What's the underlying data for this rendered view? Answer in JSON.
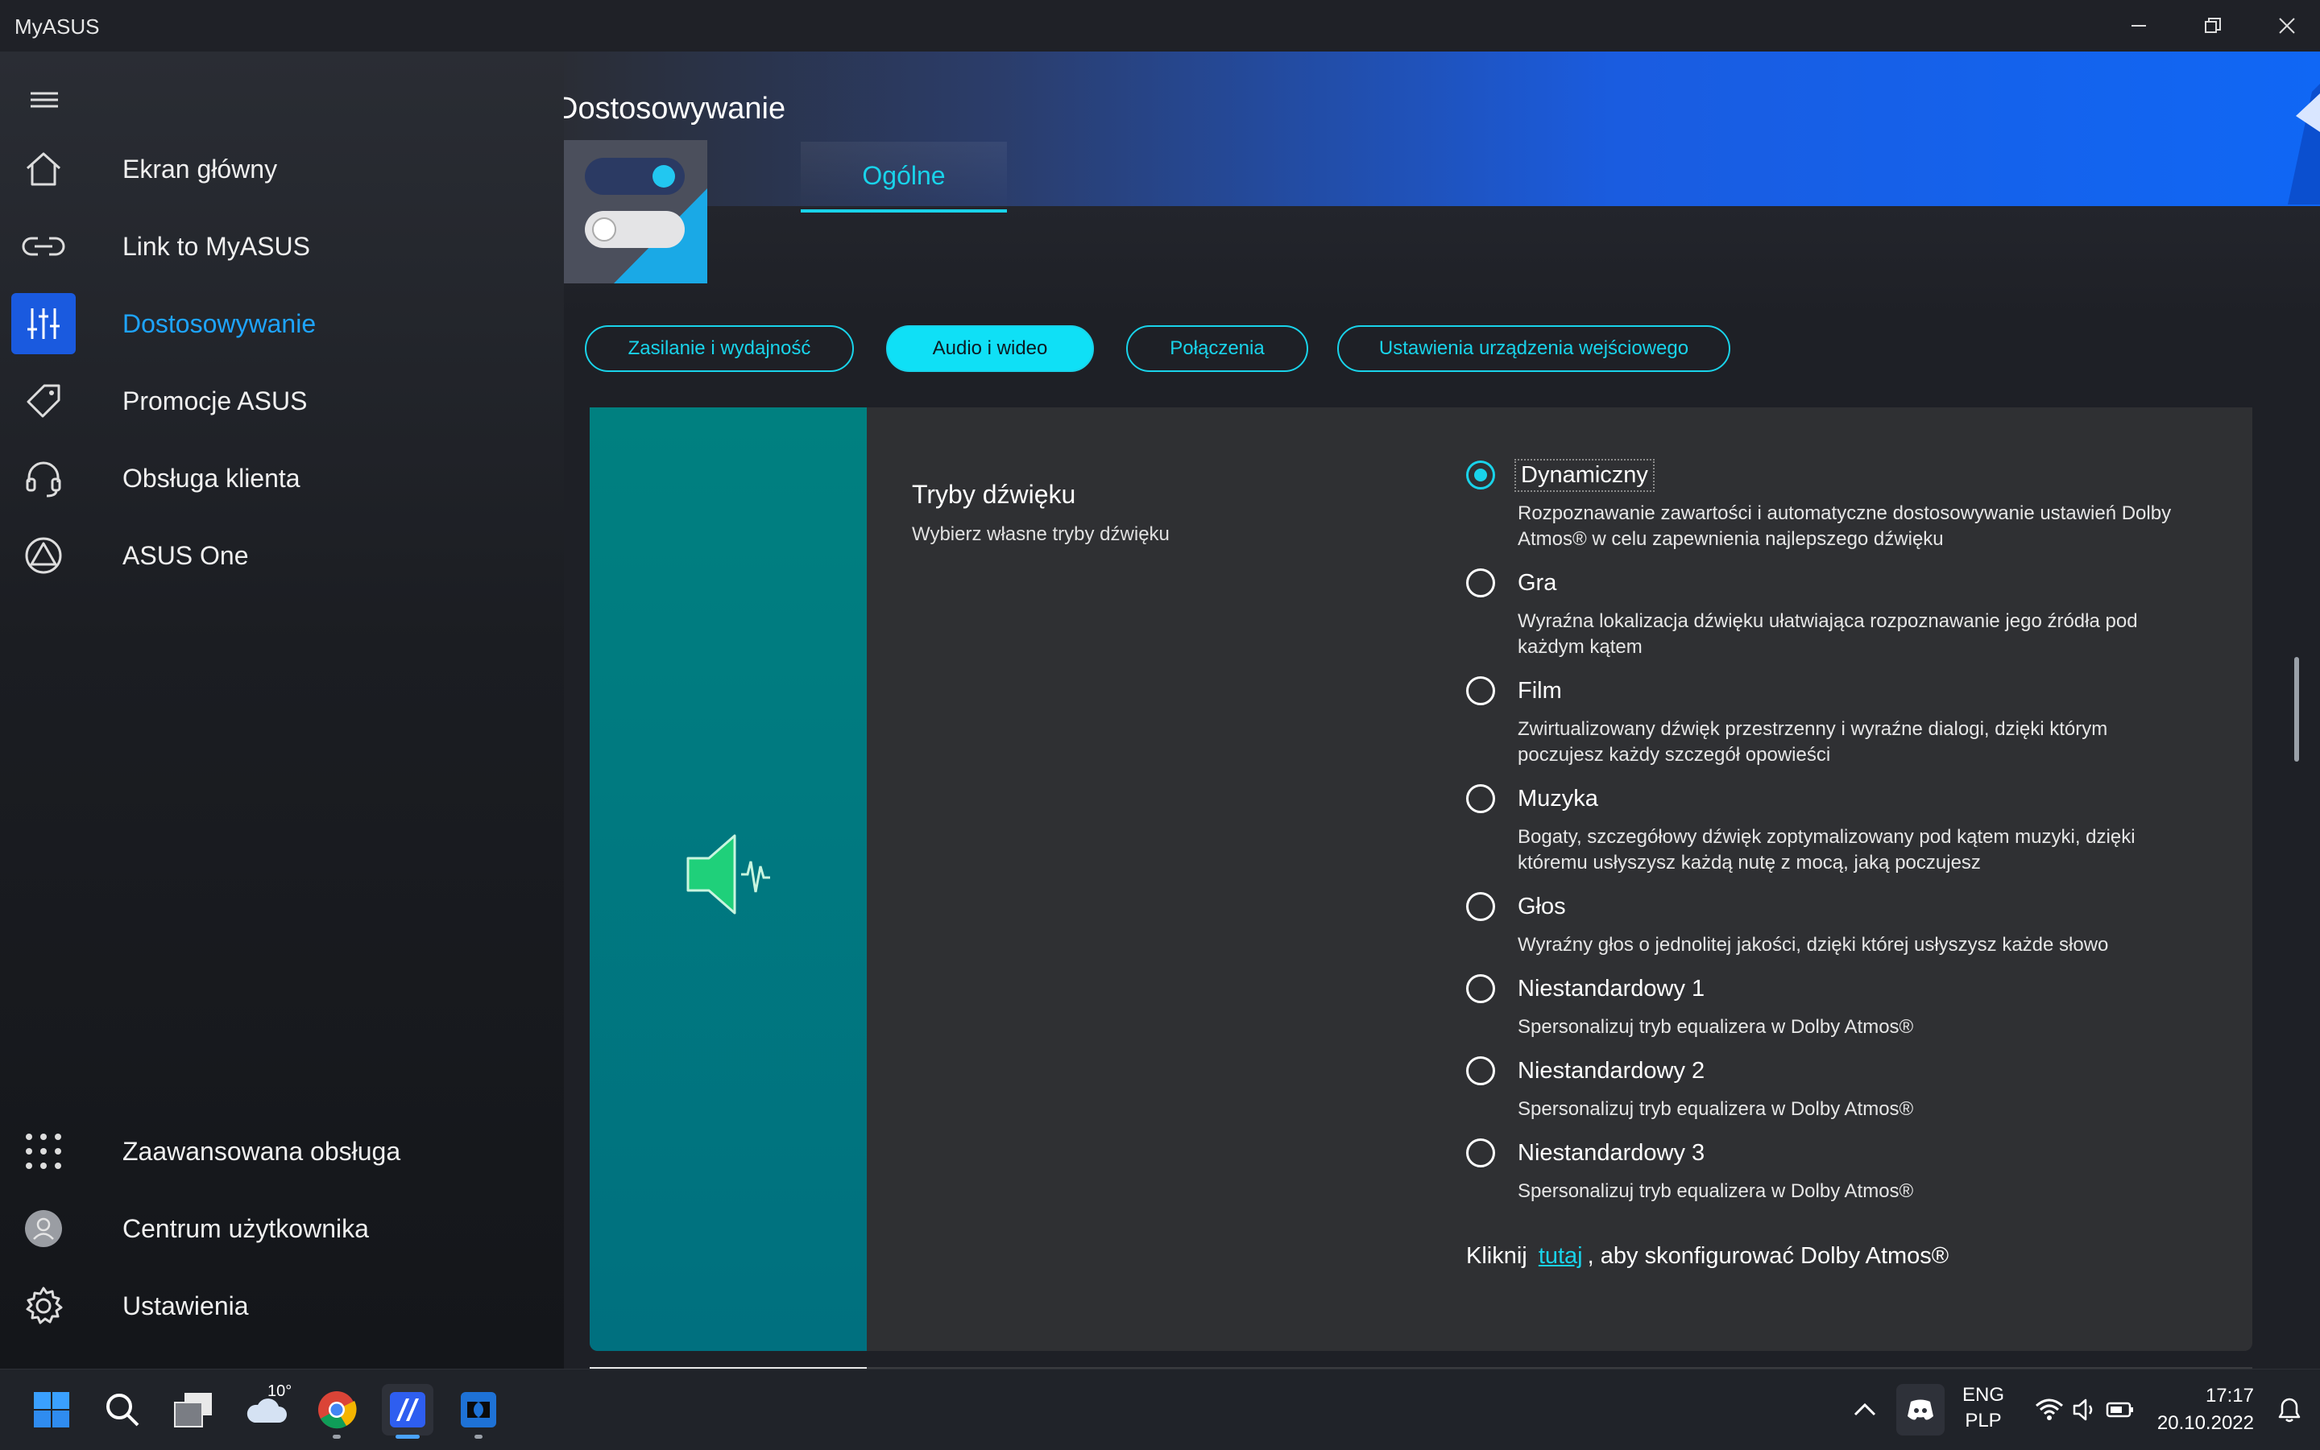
{
  "app": {
    "title": "MyASUS"
  },
  "sidebar": {
    "top_items": [
      {
        "label": "Ekran główny",
        "icon": "home-icon"
      },
      {
        "label": "Link to MyASUS",
        "icon": "link-icon"
      },
      {
        "label": "Dostosowywanie",
        "icon": "sliders-icon",
        "active": true
      },
      {
        "label": "Promocje ASUS",
        "icon": "tag-icon"
      },
      {
        "label": "Obsługa klienta",
        "icon": "headset-icon"
      },
      {
        "label": "ASUS One",
        "icon": "asus-one-icon"
      }
    ],
    "bottom_items": [
      {
        "label": "Zaawansowana obsługa",
        "icon": "grid-icon"
      },
      {
        "label": "Centrum użytkownika",
        "icon": "avatar-icon"
      },
      {
        "label": "Ustawienia",
        "icon": "gear-icon"
      }
    ]
  },
  "main": {
    "title": "Dostosowywanie",
    "tab": "Ogólne",
    "categories": [
      {
        "label": "Zasilanie i wydajność"
      },
      {
        "label": "Audio i wideo",
        "active": true
      },
      {
        "label": "Połączenia"
      },
      {
        "label": "Ustawienia urządzenia wejściowego"
      }
    ],
    "sound": {
      "title": "Tryby dźwięku",
      "subtitle": "Wybierz własne tryby dźwięku",
      "options": [
        {
          "title": "Dynamiczny",
          "desc": "Rozpoznawanie zawartości i automatyczne dostosowywanie ustawień Dolby Atmos® w celu zapewnienia najlepszego dźwięku",
          "selected": true
        },
        {
          "title": "Gra",
          "desc": "Wyraźna lokalizacja dźwięku ułatwiająca rozpoznawanie jego źródła pod każdym kątem"
        },
        {
          "title": "Film",
          "desc": "Zwirtualizowany dźwięk przestrzenny i wyraźne dialogi, dzięki którym poczujesz każdy szczegół opowieści"
        },
        {
          "title": "Muzyka",
          "desc": "Bogaty, szczegółowy dźwięk zoptymalizowany pod kątem muzyki, dzięki któremu usłyszysz każdą nutę z mocą, jaką poczujesz"
        },
        {
          "title": "Głos",
          "desc": "Wyraźny głos o jednolitej jakości, dzięki której usłyszysz każde słowo"
        },
        {
          "title": "Niestandardowy 1",
          "desc": "Spersonalizuj tryb equalizera w Dolby Atmos®"
        },
        {
          "title": "Niestandardowy 2",
          "desc": "Spersonalizuj tryb equalizera w Dolby Atmos®"
        },
        {
          "title": "Niestandardowy 3",
          "desc": "Spersonalizuj tryb equalizera w Dolby Atmos®"
        }
      ],
      "dolby_prefix": "Kliknij",
      "dolby_link": "tutaj",
      "dolby_suffix": ", aby skonfigurować Dolby Atmos®"
    }
  },
  "taskbar": {
    "weather_temp": "10°",
    "lang_top": "ENG",
    "lang_bottom": "PLP",
    "time": "17:17",
    "date": "20.10.2022"
  },
  "colors": {
    "accent": "#19d3ea",
    "brand_blue": "#1a5adf",
    "teal_panel": "#008080",
    "speaker_green": "#1fd07a"
  }
}
